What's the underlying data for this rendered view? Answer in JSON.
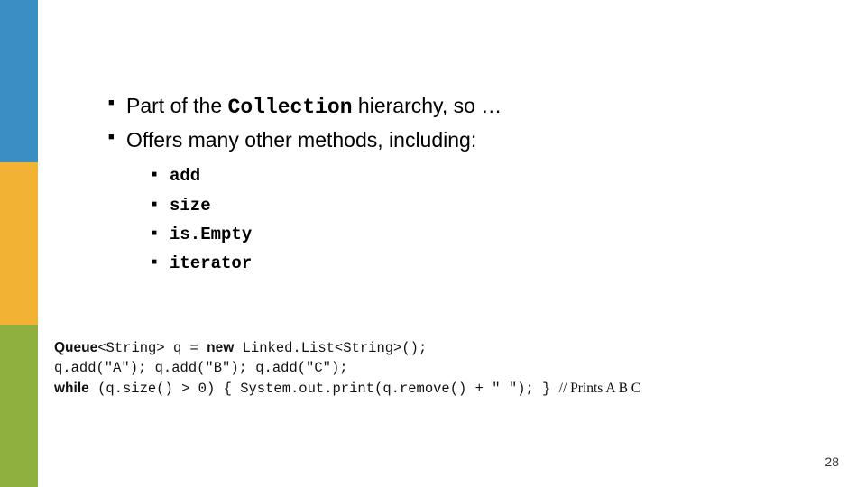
{
  "bullets": {
    "b1_pre": "Part of the ",
    "b1_code": "Collection",
    "b1_post": " hierarchy, so …",
    "b2": "Offers many other methods, including:",
    "sub": [
      "add",
      "size",
      "is.Empty",
      "iterator"
    ]
  },
  "code": {
    "l1a": "Queue",
    "l1b": "<String> q = ",
    "l1c": "new",
    "l1d": " Linked.List<String>();",
    "l2": "q.add(\"A\"); q.add(\"B\"); q.add(\"C\");",
    "l3a": "while",
    "l3b": " (q.size() > 0) { System.out.print(q.remove() + \" \"); } ",
    "l3c": "// ",
    "l3d": "Prints A B C"
  },
  "page": "28"
}
